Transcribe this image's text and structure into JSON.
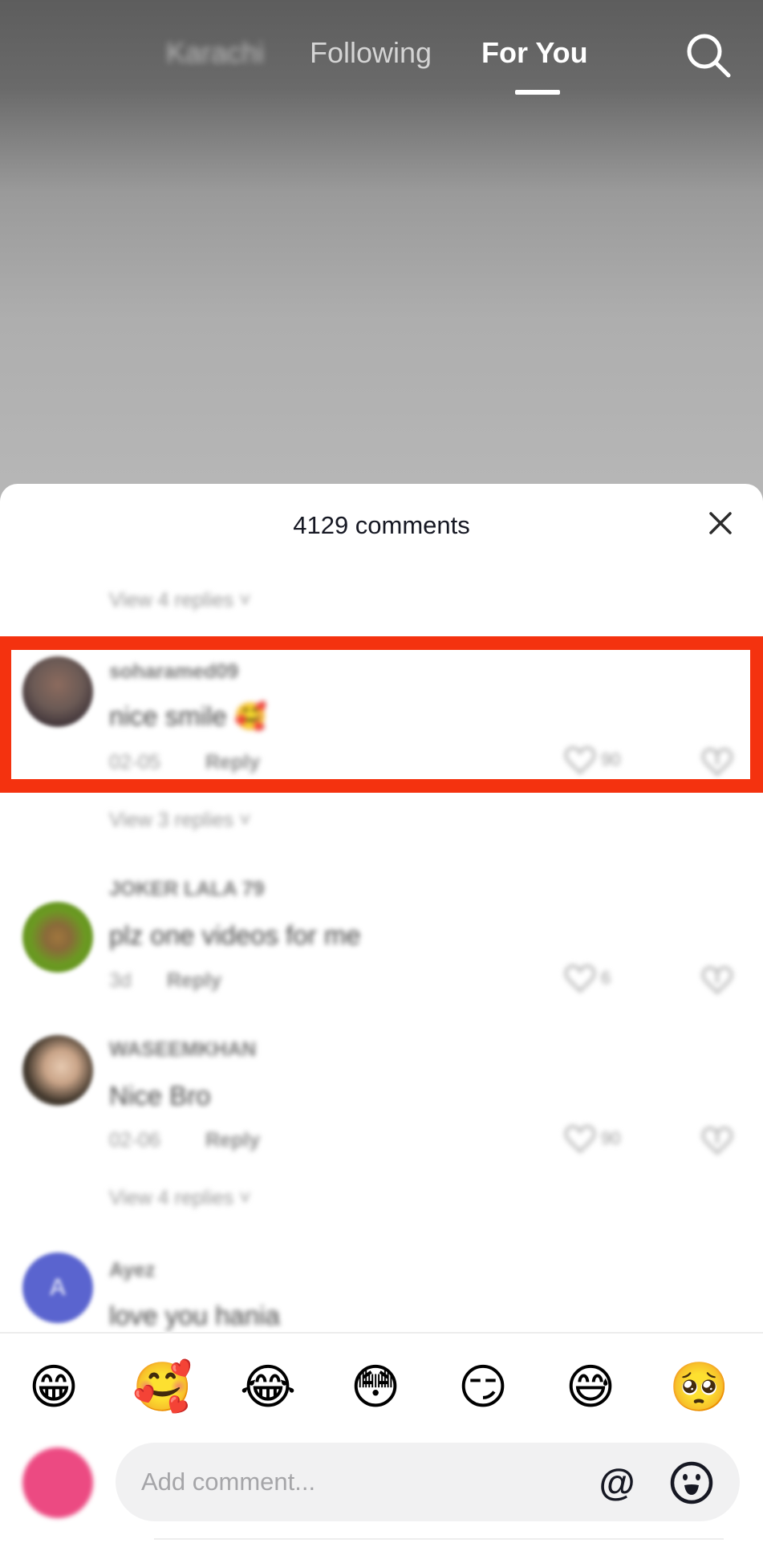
{
  "feed_tabs": {
    "items": [
      {
        "label": "Karachi",
        "active": false
      },
      {
        "label": "Following",
        "active": false
      },
      {
        "label": "For You",
        "active": true
      }
    ],
    "search_icon": "search-icon"
  },
  "comments_panel": {
    "title": "4129 comments",
    "close_icon": "close-icon",
    "top_view_replies": "View 4 replies ˅",
    "comments": [
      {
        "username": "soharamed09",
        "text": "nice smile 🥰",
        "time": "02-05",
        "reply_label": "Reply",
        "likes": "90",
        "avatar_color": "#6b5a55",
        "highlighted": true,
        "view_replies": "View 3 replies ˅"
      },
      {
        "username": "JOKER LALA 79",
        "text": "plz one videos for me",
        "time": "3d",
        "reply_label": "Reply",
        "likes": "6",
        "avatar_color": "#7fae2a",
        "highlighted": false
      },
      {
        "username": "WASEEMKHAN",
        "text": "Nice Bro",
        "time": "02-06",
        "reply_label": "Reply",
        "likes": "90",
        "avatar_color": "#8a7a66",
        "highlighted": false,
        "view_replies": "View 4 replies ˅"
      },
      {
        "username": "Ayez",
        "text": "love you hania",
        "avatar_letter": "A",
        "avatar_color": "#5a64cf",
        "highlighted": false
      }
    ],
    "highlight_color": "#f4320f"
  },
  "emoji_bar": [
    "😁",
    "🥰",
    "😂",
    "😳",
    "😏",
    "😅",
    "🥺"
  ],
  "composer": {
    "placeholder": "Add comment...",
    "value": "",
    "at_label": "@",
    "emoji_icon": "emoji-face-icon",
    "avatar_color": "#ec4a82"
  }
}
